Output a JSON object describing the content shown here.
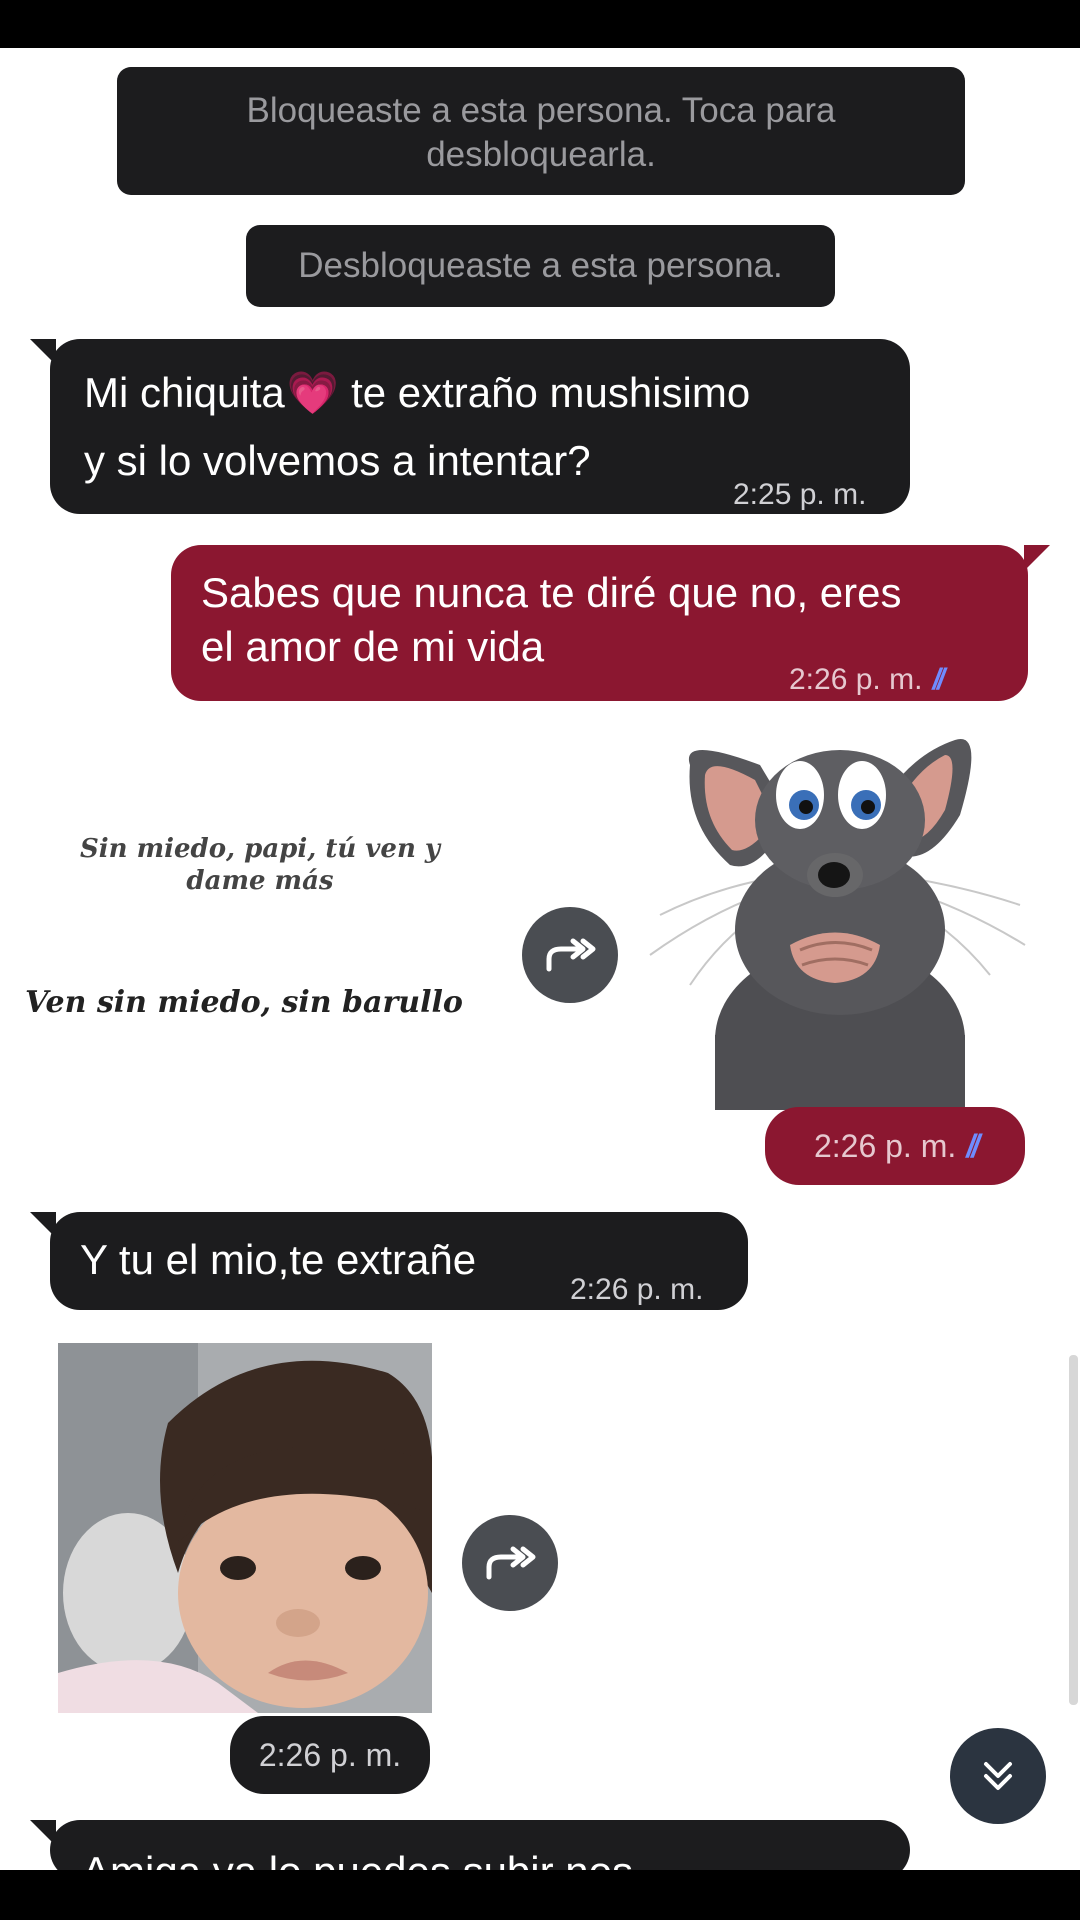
{
  "notices": {
    "blocked": "Bloqueaste a esta persona. Toca para desbloquearla.",
    "unblocked": "Desbloqueaste a esta persona."
  },
  "messages": {
    "m1": {
      "line1_a": "Mi chiquita",
      "line1_b": "te extraño mushisimo",
      "line2": "y si lo volvemos a intentar?",
      "time": "2:25 p. m.",
      "emoji": "💗"
    },
    "m2": {
      "line1": "Sabes que nunca te diré que no, eres",
      "line2": "el amor de mi vida",
      "time": "2:26 p. m."
    },
    "m3": {
      "time": "2:26 p. m."
    },
    "m4": {
      "text": "Y tu el mio,te extrañe",
      "time": "2:26 p. m."
    },
    "m5": {
      "time": "2:26 p. m."
    },
    "m6": {
      "text": "Amiga ya lo puedes subir nos"
    }
  },
  "sticker": {
    "lyric1_line1": "Sin miedo, papi, tú ven y",
    "lyric1_line2": "dame más",
    "lyric2": "Ven sin miedo, sin barullo"
  },
  "icons": {
    "forward": "forward-icon",
    "double_chevron": "double-chevron-down-icon",
    "read_ticks": "double-check-icon"
  },
  "colors": {
    "incoming_bubble": "#1c1c1e",
    "outgoing_bubble": "#8b1730",
    "read_ticks": "#6f8cff"
  }
}
